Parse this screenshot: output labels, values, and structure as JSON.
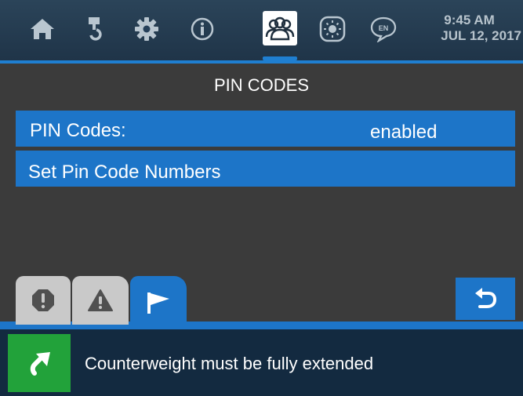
{
  "header": {
    "nav": [
      {
        "icon": "home-icon"
      },
      {
        "icon": "boom-hook-icon"
      },
      {
        "icon": "gear-icon"
      },
      {
        "icon": "info-icon"
      },
      {
        "icon": "users-icon"
      },
      {
        "icon": "brightness-icon"
      },
      {
        "icon": "language-icon",
        "label": "EN"
      }
    ],
    "time": "9:45 AM",
    "date": "JUL 12, 2017"
  },
  "page": {
    "title": "PIN CODES"
  },
  "menu": {
    "pin_codes": {
      "label": "PIN Codes:",
      "value": "enabled"
    },
    "set_numbers": {
      "label": "Set Pin Code Numbers"
    }
  },
  "tabs": [
    {
      "icon": "stop-alert-icon"
    },
    {
      "icon": "warning-icon"
    },
    {
      "icon": "flag-icon"
    }
  ],
  "back": {
    "icon": "back-arrow-icon"
  },
  "status": {
    "icon": "return-arrow-icon",
    "message": "Counterweight must be fully extended",
    "colors": {
      "bar": "#132a40",
      "icon_bg": "#22a23a"
    }
  },
  "colors": {
    "accent": "#1d75c8",
    "background": "#3b3b3b",
    "header": "#25394c"
  }
}
